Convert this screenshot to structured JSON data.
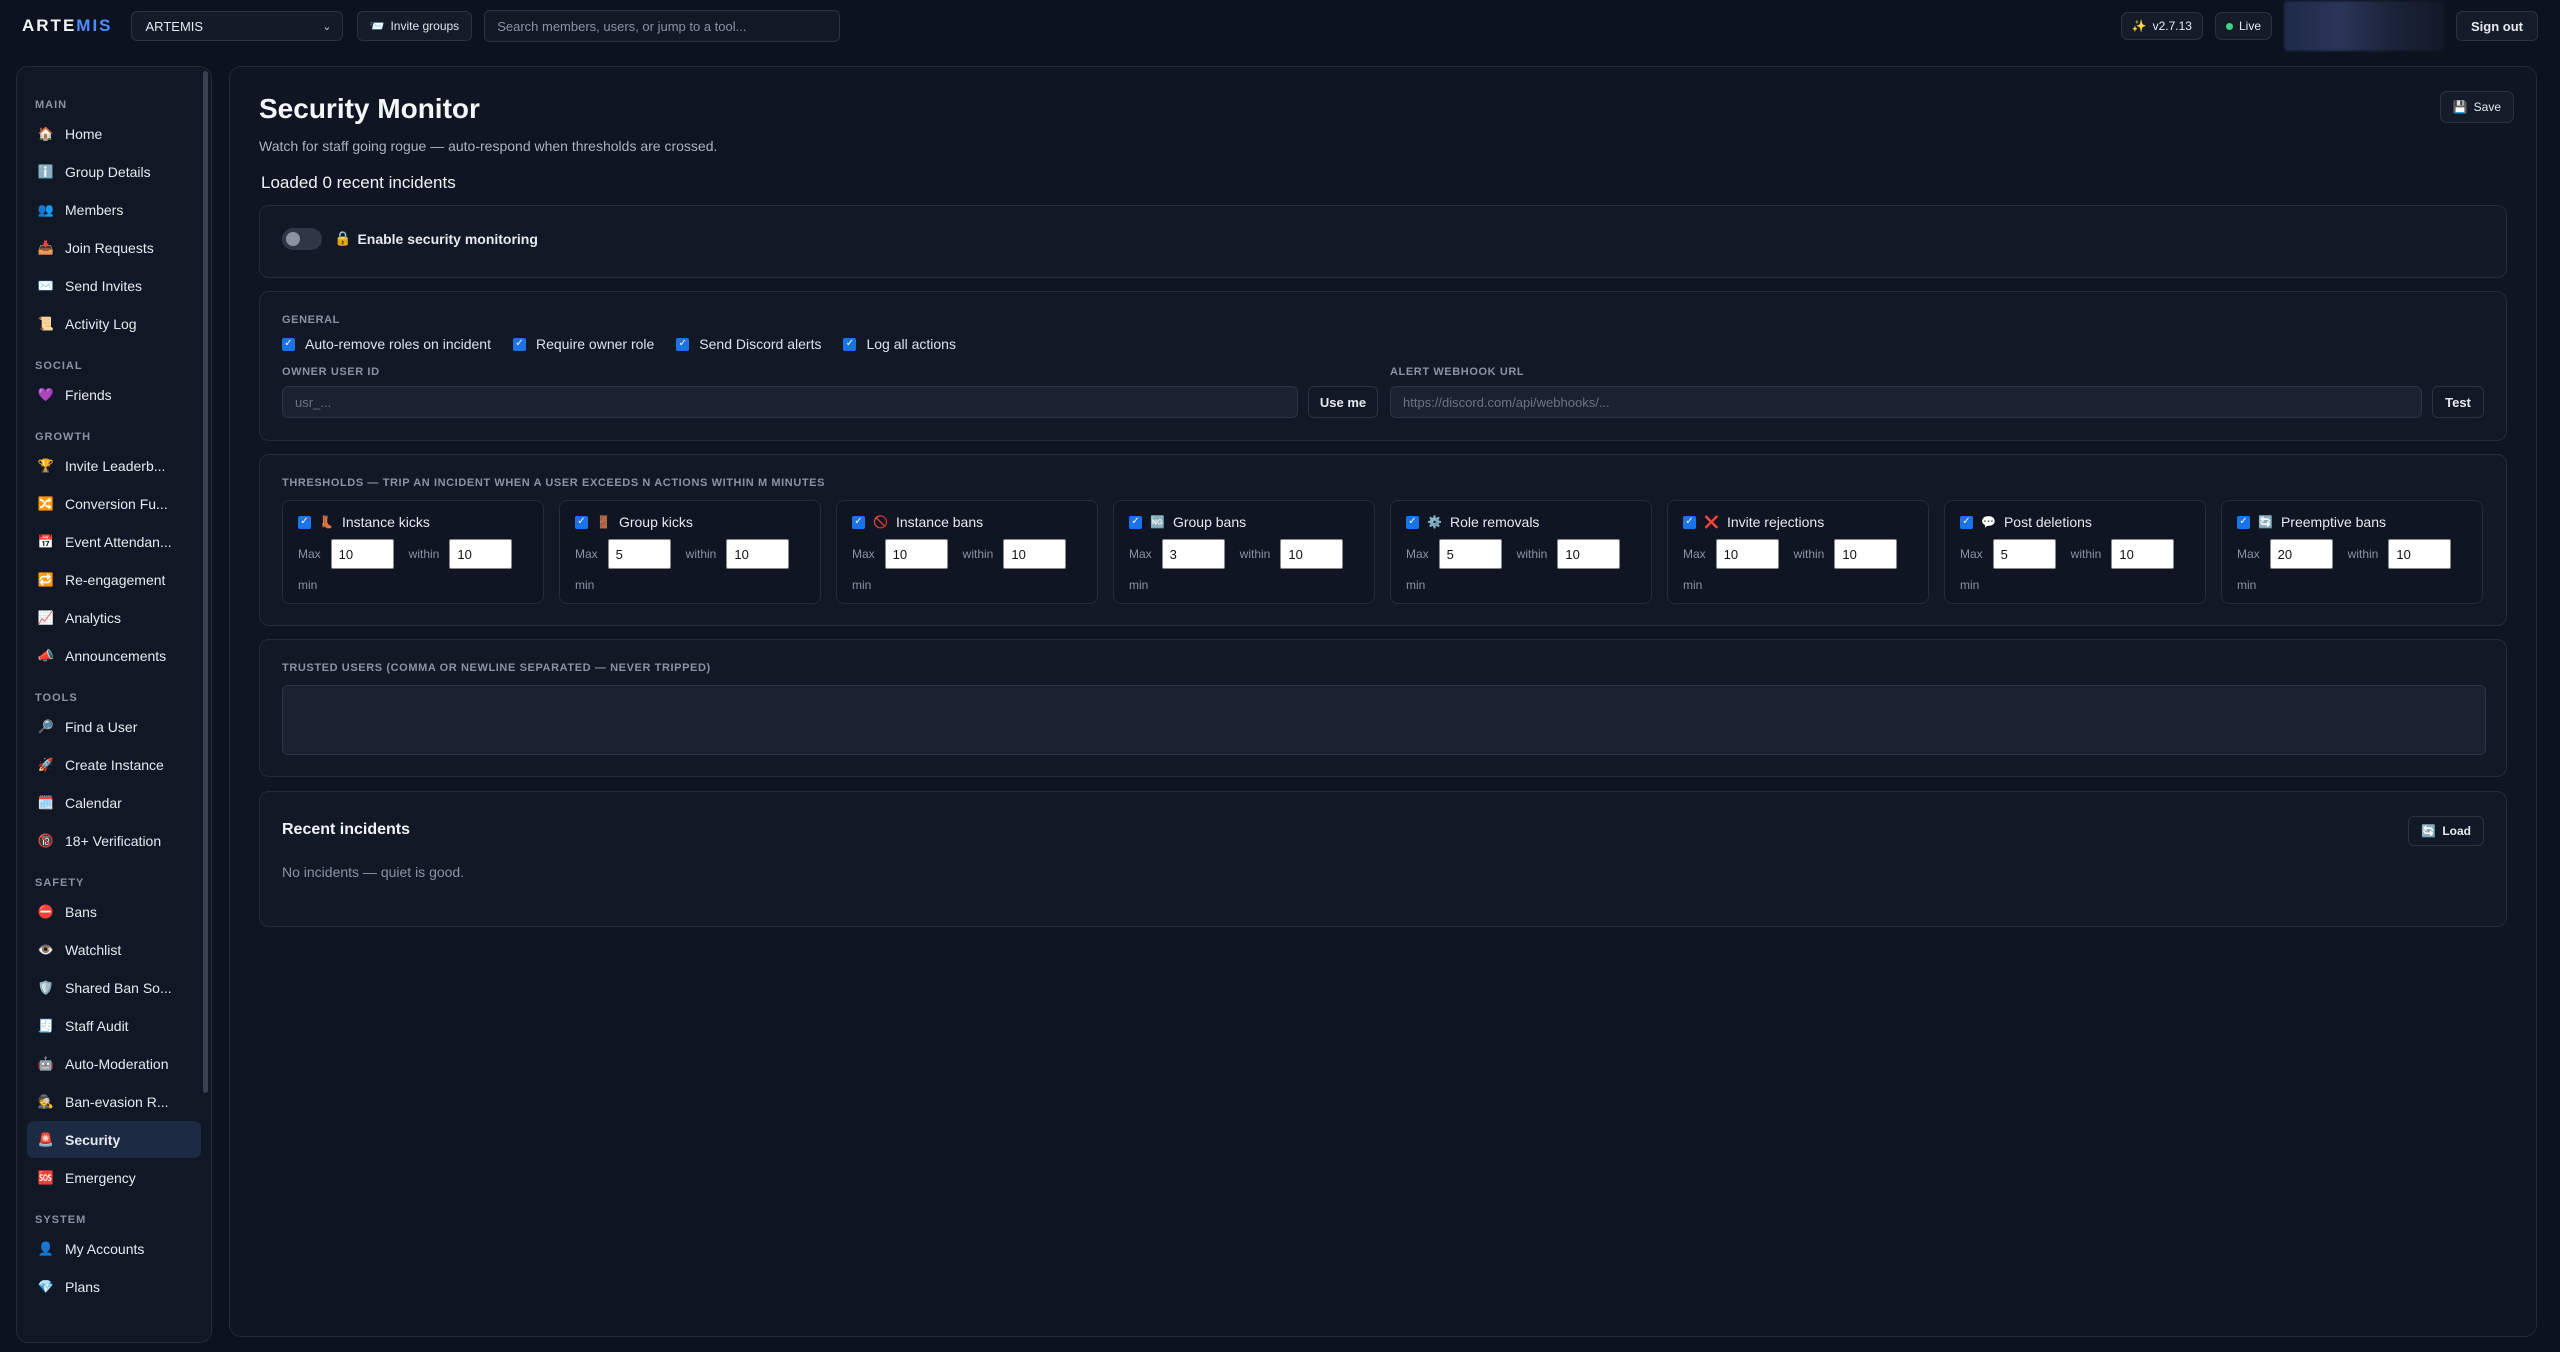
{
  "app": {
    "logo_main": "ARTE",
    "logo_accent": "MIS",
    "group_selected": "ARTEMIS",
    "invite_groups_label": "Invite groups",
    "search_placeholder": "Search members, users, or jump to a tool...",
    "version": "v2.7.13",
    "live_label": "Live",
    "sign_out": "Sign out",
    "colors": {
      "accent": "#4d8dff",
      "live": "#3fd47f",
      "checkbox": "#1a73e8"
    }
  },
  "sidebar": {
    "sections": [
      {
        "title": "MAIN",
        "items": [
          {
            "label": "Home",
            "icon": "🏠"
          },
          {
            "label": "Group Details",
            "icon": "ℹ️"
          },
          {
            "label": "Members",
            "icon": "👥"
          },
          {
            "label": "Join Requests",
            "icon": "📥"
          },
          {
            "label": "Send Invites",
            "icon": "✉️"
          },
          {
            "label": "Activity Log",
            "icon": "📜"
          }
        ]
      },
      {
        "title": "SOCIAL",
        "items": [
          {
            "label": "Friends",
            "icon": "💜"
          }
        ]
      },
      {
        "title": "GROWTH",
        "items": [
          {
            "label": "Invite Leaderb...",
            "icon": "🏆"
          },
          {
            "label": "Conversion Fu...",
            "icon": "🔀"
          },
          {
            "label": "Event Attendan...",
            "icon": "📅"
          },
          {
            "label": "Re-engagement",
            "icon": "🔁"
          },
          {
            "label": "Analytics",
            "icon": "📈"
          },
          {
            "label": "Announcements",
            "icon": "📣"
          }
        ]
      },
      {
        "title": "TOOLS",
        "items": [
          {
            "label": "Find a User",
            "icon": "🔎"
          },
          {
            "label": "Create Instance",
            "icon": "🚀"
          },
          {
            "label": "Calendar",
            "icon": "🗓️"
          },
          {
            "label": "18+ Verification",
            "icon": "🔞"
          }
        ]
      },
      {
        "title": "SAFETY",
        "items": [
          {
            "label": "Bans",
            "icon": "⛔"
          },
          {
            "label": "Watchlist",
            "icon": "👁️"
          },
          {
            "label": "Shared Ban So...",
            "icon": "🛡️"
          },
          {
            "label": "Staff Audit",
            "icon": "🧾"
          },
          {
            "label": "Auto-Moderation",
            "icon": "🤖"
          },
          {
            "label": "Ban-evasion R...",
            "icon": "🕵️"
          },
          {
            "label": "Security",
            "icon": "🚨",
            "active": true
          },
          {
            "label": "Emergency",
            "icon": "🆘"
          }
        ]
      },
      {
        "title": "SYSTEM",
        "items": [
          {
            "label": "My Accounts",
            "icon": "👤"
          },
          {
            "label": "Plans",
            "icon": "💎"
          }
        ]
      }
    ]
  },
  "main": {
    "title": "Security Monitor",
    "subtitle": "Watch for staff going rogue — auto-respond when thresholds are crossed.",
    "save_label": "Save",
    "loaded_text": "Loaded 0 recent incidents",
    "enable": {
      "label": "Enable security monitoring",
      "enabled": false
    },
    "general": {
      "title": "GENERAL",
      "checkboxes": [
        {
          "label": "Auto-remove roles on incident",
          "checked": true
        },
        {
          "label": "Require owner role",
          "checked": true
        },
        {
          "label": "Send Discord alerts",
          "checked": true
        },
        {
          "label": "Log all actions",
          "checked": true
        }
      ],
      "owner_label": "OWNER USER ID",
      "owner_placeholder": "usr_...",
      "use_me_label": "Use me",
      "webhook_label": "ALERT WEBHOOK URL",
      "webhook_placeholder": "https://discord.com/api/webhooks/...",
      "test_label": "Test"
    },
    "thresholds": {
      "title": "THRESHOLDS — TRIP AN INCIDENT WHEN A USER EXCEEDS N ACTIONS WITHIN M MINUTES",
      "max_label": "Max",
      "within_label": "within",
      "min_label": "min",
      "items": [
        {
          "label": "Instance kicks",
          "icon": "👢",
          "max": "10",
          "within": "10",
          "checked": true
        },
        {
          "label": "Group kicks",
          "icon": "🚪",
          "max": "5",
          "within": "10",
          "checked": true
        },
        {
          "label": "Instance bans",
          "icon": "🚫",
          "max": "10",
          "within": "10",
          "checked": true
        },
        {
          "label": "Group bans",
          "icon": "🆖",
          "max": "3",
          "within": "10",
          "checked": true
        },
        {
          "label": "Role removals",
          "icon": "⚙️",
          "max": "5",
          "within": "10",
          "checked": true
        },
        {
          "label": "Invite rejections",
          "icon": "❌",
          "max": "10",
          "within": "10",
          "checked": true
        },
        {
          "label": "Post deletions",
          "icon": "💬",
          "max": "5",
          "within": "10",
          "checked": true
        },
        {
          "label": "Preemptive bans",
          "icon": "🔄",
          "max": "20",
          "within": "10",
          "checked": true
        }
      ]
    },
    "trusted": {
      "title": "TRUSTED USERS (COMMA OR NEWLINE SEPARATED — NEVER TRIPPED)"
    },
    "incidents": {
      "title": "Recent incidents",
      "load_label": "Load",
      "empty_text": "No incidents — quiet is good."
    }
  }
}
